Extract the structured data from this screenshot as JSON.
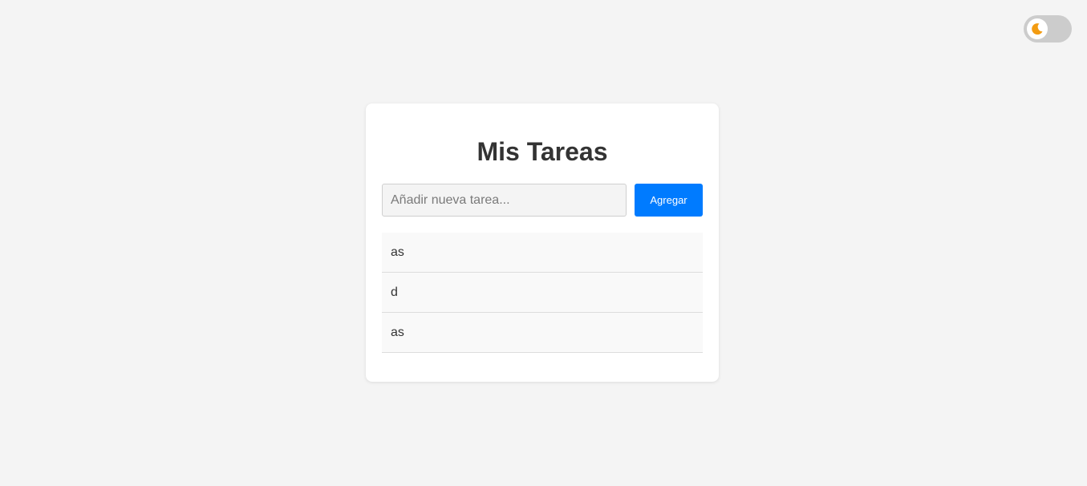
{
  "theme_toggle": {
    "icon": "moon-icon",
    "state": "off",
    "icon_color": "#f39c12",
    "track_color": "#cccccc"
  },
  "card": {
    "title": "Mis Tareas"
  },
  "new_task": {
    "placeholder": "Añadir nueva tarea...",
    "value": "",
    "button_label": "Agregar",
    "button_color": "#007bff"
  },
  "tasks": [
    {
      "text": "as"
    },
    {
      "text": "d"
    },
    {
      "text": "as"
    }
  ]
}
